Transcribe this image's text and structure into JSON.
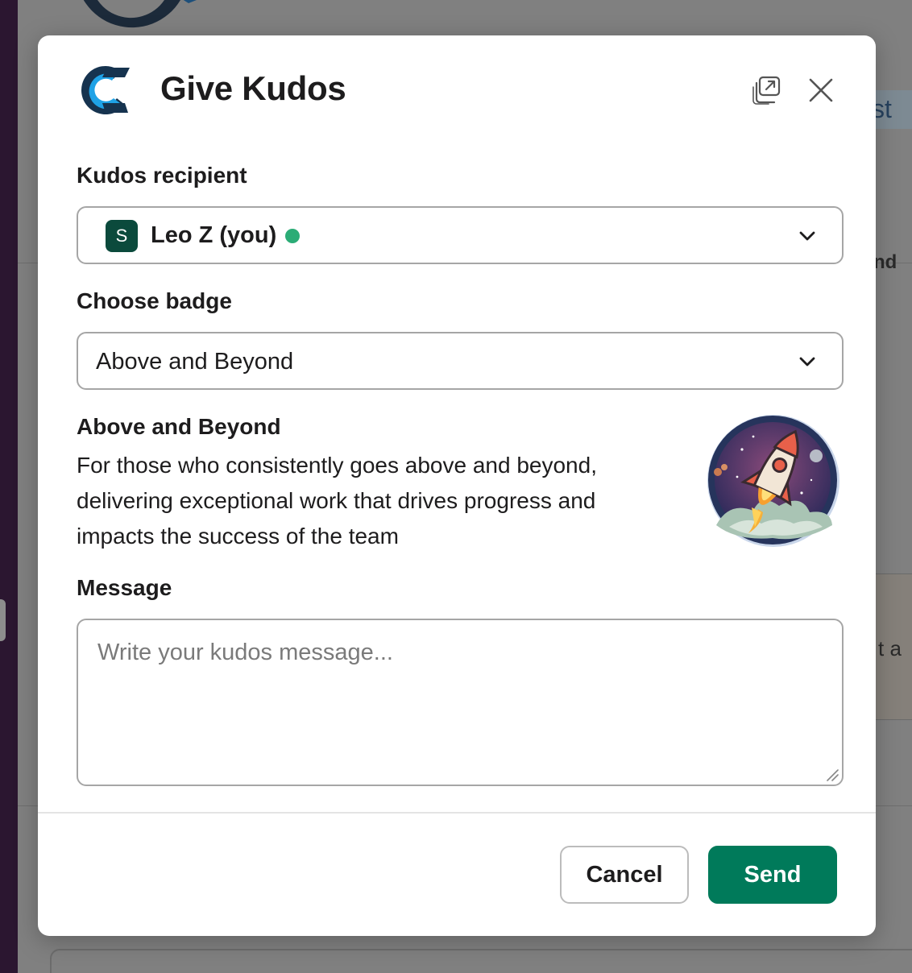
{
  "modal": {
    "title": "Give Kudos",
    "app_logo_icon": "kudos-app-logo",
    "popout_icon": "popout-icon",
    "close_icon": "close-icon"
  },
  "recipient": {
    "label": "Kudos recipient",
    "avatar_initial": "S",
    "avatar_color": "#0b4a3c",
    "name": "Leo Z (you)",
    "presence": "active",
    "presence_color": "#2bac76"
  },
  "badge": {
    "label": "Choose badge",
    "selected": "Above and Beyond",
    "title": "Above and Beyond",
    "description": "For those who consistently goes above and beyond, delivering exceptional work that drives progress and impacts the success of the team",
    "image_icon": "rocket-badge-icon"
  },
  "message": {
    "label": "Message",
    "placeholder": "Write your kudos message..."
  },
  "footer": {
    "cancel_label": "Cancel",
    "send_label": "Send",
    "send_color": "#007a5a"
  },
  "background": {
    "fragment_1": "st",
    "fragment_2": "nd",
    "fragment_3": "t a"
  }
}
